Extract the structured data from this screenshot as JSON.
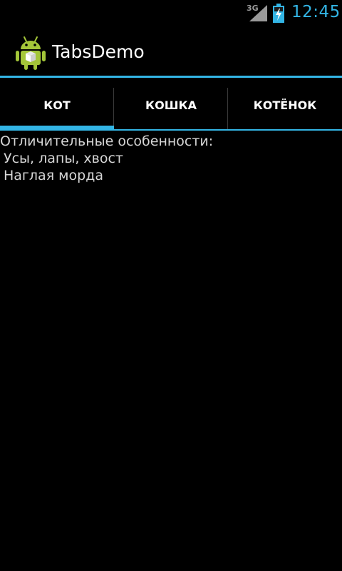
{
  "status_bar": {
    "network": "3G",
    "time": "12:45",
    "accent_color": "#33b5e5"
  },
  "action_bar": {
    "app_icon": "android-robot-icon",
    "title": "TabsDemo"
  },
  "tabs": [
    {
      "label": "КОТ",
      "active": true
    },
    {
      "label": "КОШКА",
      "active": false
    },
    {
      "label": "КОТЁНОК",
      "active": false
    }
  ],
  "content": {
    "heading": "Отличительные особенности:",
    "lines": [
      "Усы, лапы, хвост",
      "Наглая морда"
    ]
  }
}
